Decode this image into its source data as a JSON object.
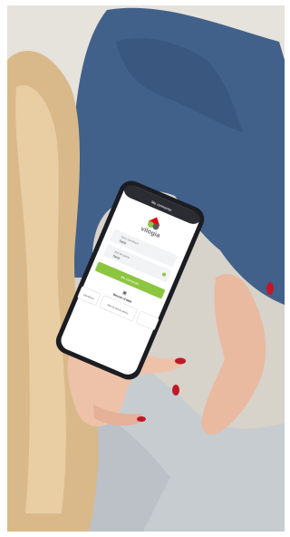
{
  "phone": {
    "header_title": "Me connecter",
    "brand_name": "vilogia",
    "login_id_label": "Votre identifiant",
    "login_id_value": "Saisir",
    "password_label": "Mot de passe",
    "password_value": "Saisir",
    "connect_button": "Me connecter",
    "help_title": "Besoin d'aide",
    "help_left_card": "Identifiant",
    "help_middle_card": "Mot de passe perdu",
    "help_right_card": ""
  },
  "colors": {
    "accent_green": "#8cc63f",
    "brand_red": "#e30613",
    "phone_body": "#1b1d22",
    "jeans": "#3f5f86",
    "nails": "#c0182a"
  }
}
